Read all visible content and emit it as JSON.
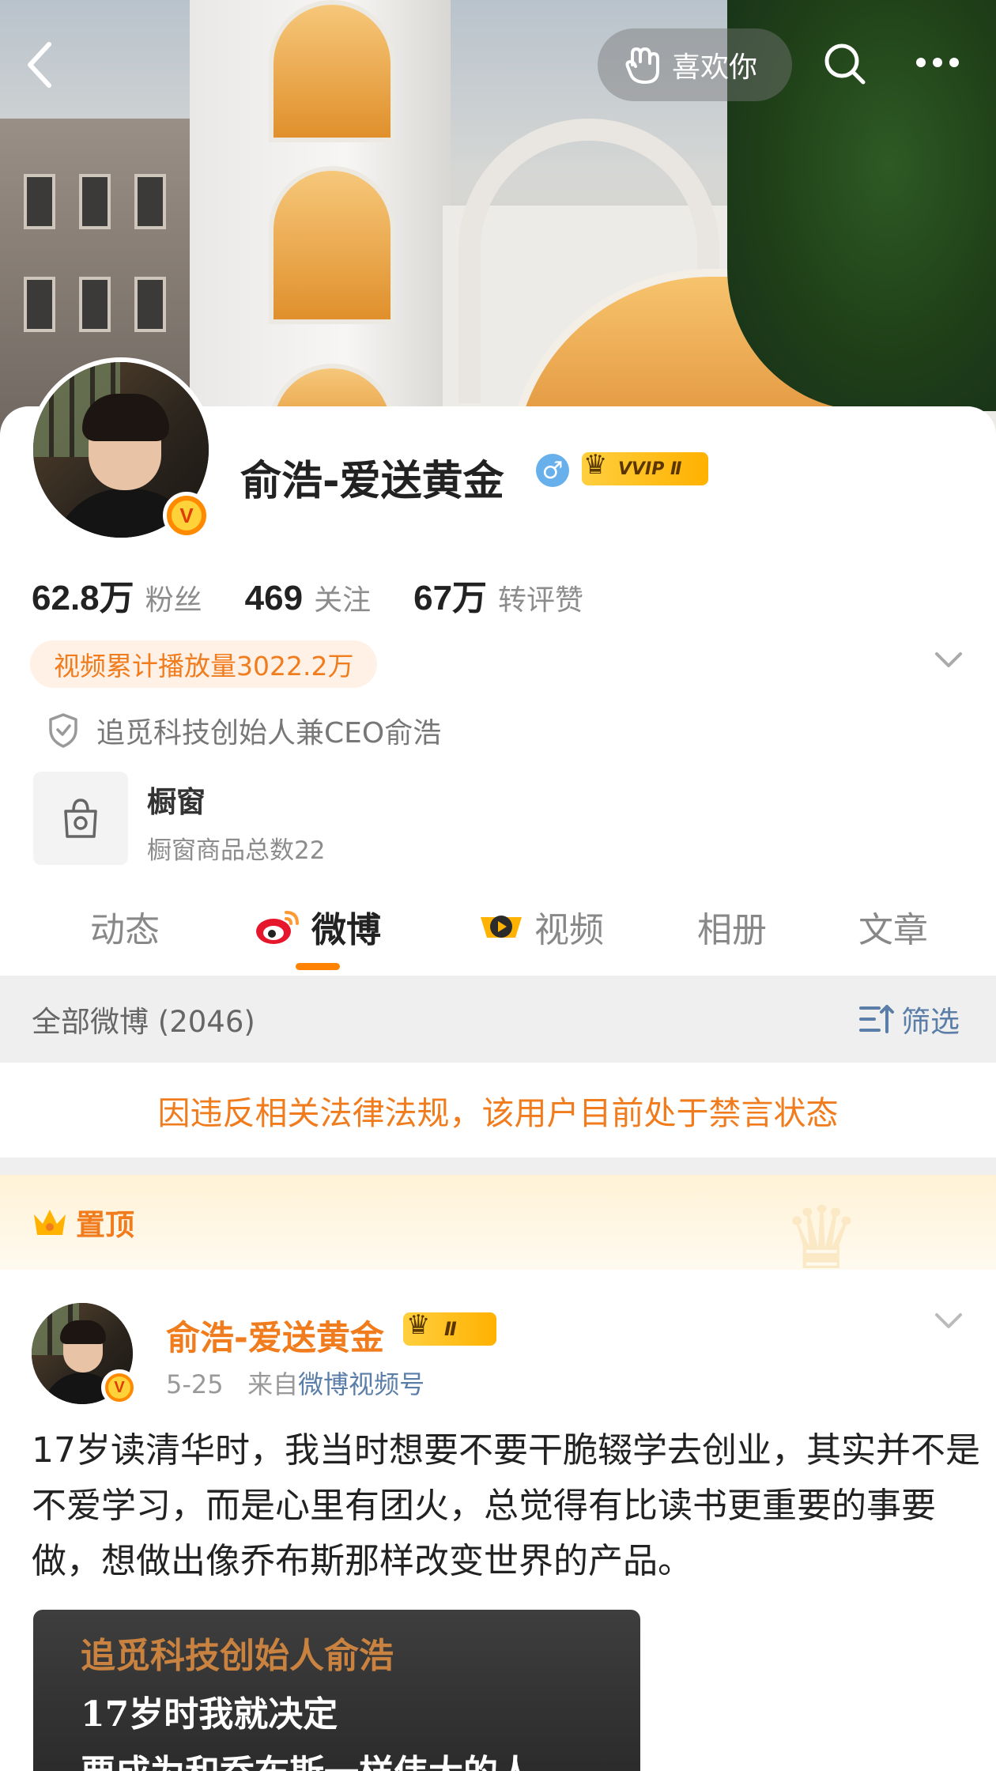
{
  "header": {
    "like_label": "喜欢你",
    "icons": [
      "back-icon",
      "hand-wave-icon",
      "search-icon",
      "more-icon"
    ]
  },
  "profile": {
    "name": "俞浩-爱送黄金",
    "gender_symbol": "♂",
    "vip_label": "VVIP Ⅱ",
    "verified_symbol": "V",
    "stats": [
      {
        "value": "62.8万",
        "label": "粉丝"
      },
      {
        "value": "469",
        "label": "关注"
      },
      {
        "value": "67万",
        "label": "转评赞"
      }
    ],
    "play_count": "视频累计播放量3022.2万",
    "verification": "追觅科技创始人兼CEO俞浩",
    "shop": {
      "title": "橱窗",
      "subtitle": "橱窗商品总数22"
    }
  },
  "tabs": [
    {
      "label": "动态",
      "active": false
    },
    {
      "label": "微博",
      "active": true
    },
    {
      "label": "视频",
      "active": false
    },
    {
      "label": "相册",
      "active": false
    },
    {
      "label": "文章",
      "active": false
    }
  ],
  "filter": {
    "all_label": "全部微博 (2046)",
    "filter_label": "筛选"
  },
  "notice": "因违反相关法律法规，该用户目前处于禁言状态",
  "pinned_label": "置顶",
  "post": {
    "author": "俞浩-爱送黄金",
    "badge": "Ⅱ",
    "date": "5-25",
    "from_prefix": "来自",
    "source": "微博视频号",
    "text": "17岁读清华时，我当时想要不要干脆辍学去创业，其实并不是不爱学习，而是心里有团火，总觉得有比读书更重要的事要做，想做出像乔布斯那样改变世界的产品。",
    "thumbnail_lines": [
      "追觅科技创始人俞浩",
      "17岁时我就决定",
      "要成为和乔布斯一样伟大的人"
    ]
  },
  "colors": {
    "accent": "#ff8200",
    "orange_text": "#f07c1e",
    "link_blue": "#5a7ea8",
    "gray_bg": "#efefef"
  }
}
